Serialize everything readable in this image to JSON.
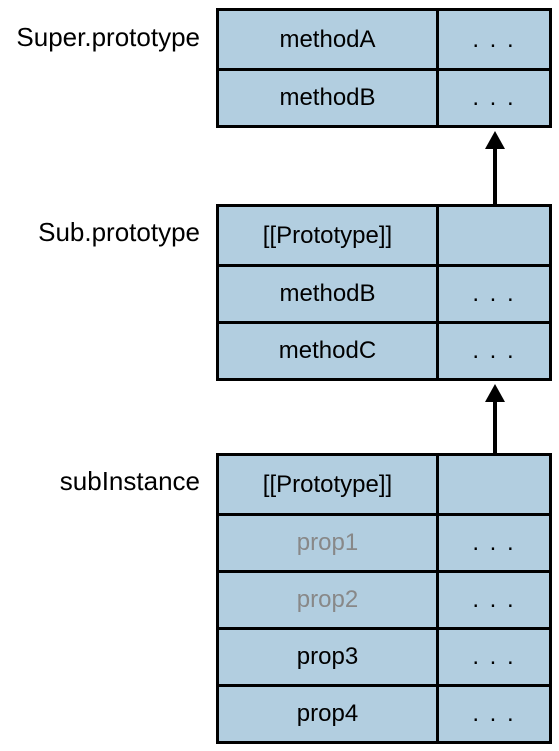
{
  "labels": {
    "super": "Super.prototype",
    "sub": "Sub.prototype",
    "instance": "subInstance"
  },
  "blocks": {
    "super": {
      "rows": [
        {
          "key": "methodA",
          "val": ". . .",
          "dim": false
        },
        {
          "key": "methodB",
          "val": ". . .",
          "dim": false
        }
      ]
    },
    "sub": {
      "rows": [
        {
          "key": "[[Prototype]]",
          "val": "",
          "dim": false
        },
        {
          "key": "methodB",
          "val": ". . .",
          "dim": false
        },
        {
          "key": "methodC",
          "val": ". . .",
          "dim": false
        }
      ]
    },
    "instance": {
      "rows": [
        {
          "key": "[[Prototype]]",
          "val": "",
          "dim": false
        },
        {
          "key": "prop1",
          "val": ". . .",
          "dim": true
        },
        {
          "key": "prop2",
          "val": ". . .",
          "dim": true
        },
        {
          "key": "prop3",
          "val": ". . .",
          "dim": false
        },
        {
          "key": "prop4",
          "val": ". . .",
          "dim": false
        }
      ]
    }
  }
}
